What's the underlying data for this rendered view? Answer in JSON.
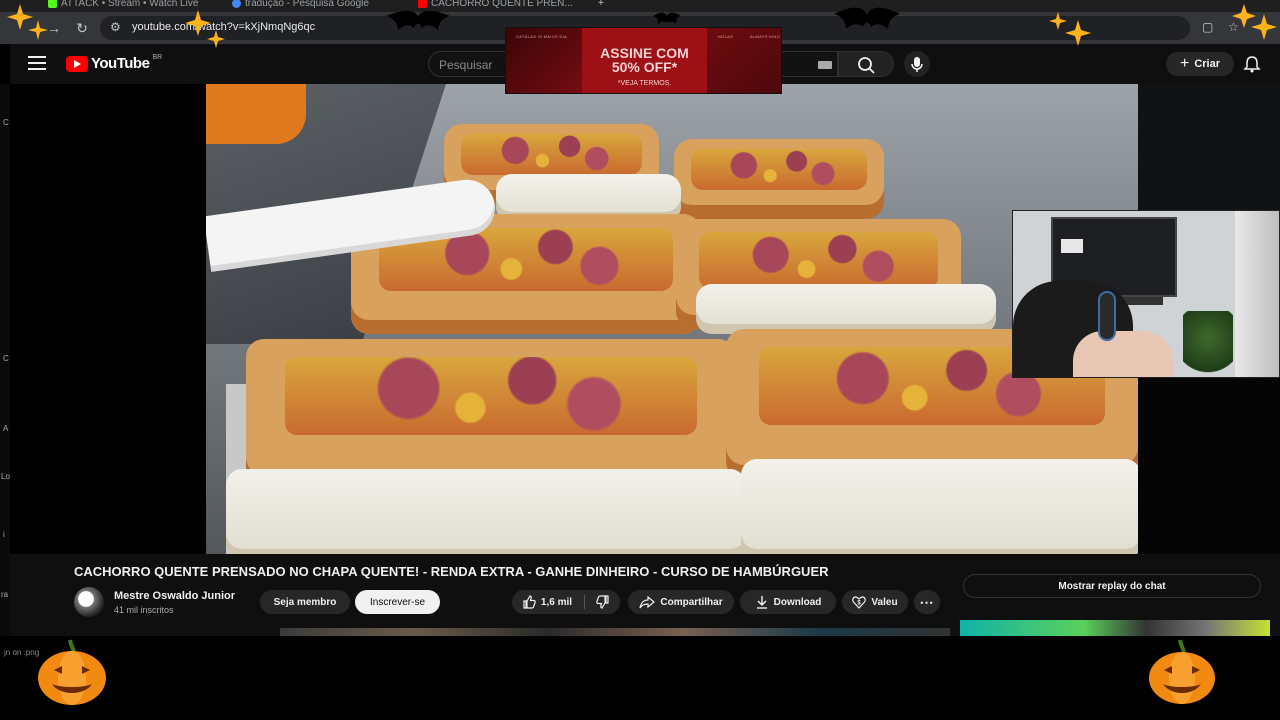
{
  "browser": {
    "tabs": [
      {
        "label": "ATTACK • Stream • Watch Live",
        "favicon_color": "#53fc18"
      },
      {
        "label": "tradução - Pesquisa Google",
        "favicon_color": "#4285f4"
      },
      {
        "label": "CACHORRO QUENTE PREN...",
        "favicon_color": "#ff0000"
      }
    ],
    "url": "youtube.com/watch?v=kXjNmqNg6qc"
  },
  "youtube": {
    "logo_text": "YouTube",
    "country_code": "BR",
    "search_placeholder": "Pesquisar",
    "create_label": "Criar"
  },
  "ad": {
    "small_left": "CATÁLAG IS MAIOS DIA",
    "small_mid": "NOLAG",
    "small_right": "ALWAYS KING",
    "line1": "ASSINE COM",
    "line2": "50% OFF*",
    "line3": "*VEJA TERMOS."
  },
  "sidebar_chars": [
    "C",
    "C",
    "A",
    "Lo",
    "i",
    "ra"
  ],
  "video": {
    "title": "CACHORRO QUENTE PRENSADO NO CHAPA QUENTE! - RENDA EXTRA - GANHE DINHEIRO - CURSO DE HAMBÚRGUER",
    "channel_name": "Mestre Oswaldo Junior",
    "subscribers": "41 mil inscritos",
    "join_label": "Seja membro",
    "subscribe_label": "Inscrever-se",
    "likes": "1,6 mil",
    "share_label": "Compartilhar",
    "download_label": "Download",
    "thanks_label": "Valeu",
    "chat_replay_label": "Mostrar replay do chat"
  },
  "overlay": {
    "bottom_text": "jn on .png"
  },
  "colors": {
    "accent": "#ff0000",
    "star": "#ffb21a",
    "pumpkin": "#f28a12"
  }
}
